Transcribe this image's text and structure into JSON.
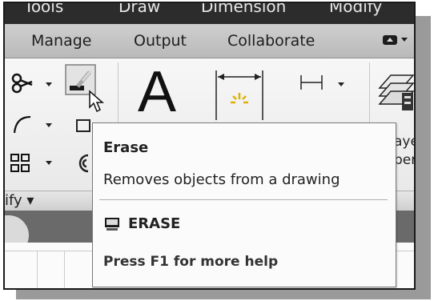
{
  "menu": [
    "Tools",
    "Draw",
    "Dimension",
    "Modify"
  ],
  "ribbon_tabs": [
    "Manage",
    "Output",
    "Collaborate"
  ],
  "panel": {
    "label": "ify ▾"
  },
  "tools": {
    "text_icon_glyph": "A",
    "layer_props_label_line1": "ayer",
    "layer_props_label_line2": "pert"
  },
  "icons": [
    "scissors-icon",
    "erase-icon",
    "fillet-icon",
    "array-icon",
    "offset-icon",
    "text-icon",
    "linear-dimension-icon",
    "dim-dropdown-icon",
    "layer-properties-icon",
    "cursor-arrow-icon",
    "erase-command-icon"
  ],
  "tooltip": {
    "title": "Erase",
    "description": "Removes objects from a drawing",
    "command": "ERASE",
    "help": "Press F1 for more help"
  },
  "colors": {
    "menubar": "#2c2c2c",
    "tabrow": "#c4c4c4",
    "ribbon": "#f2f2f2",
    "tooltip_bg": "#fbfbfb"
  }
}
